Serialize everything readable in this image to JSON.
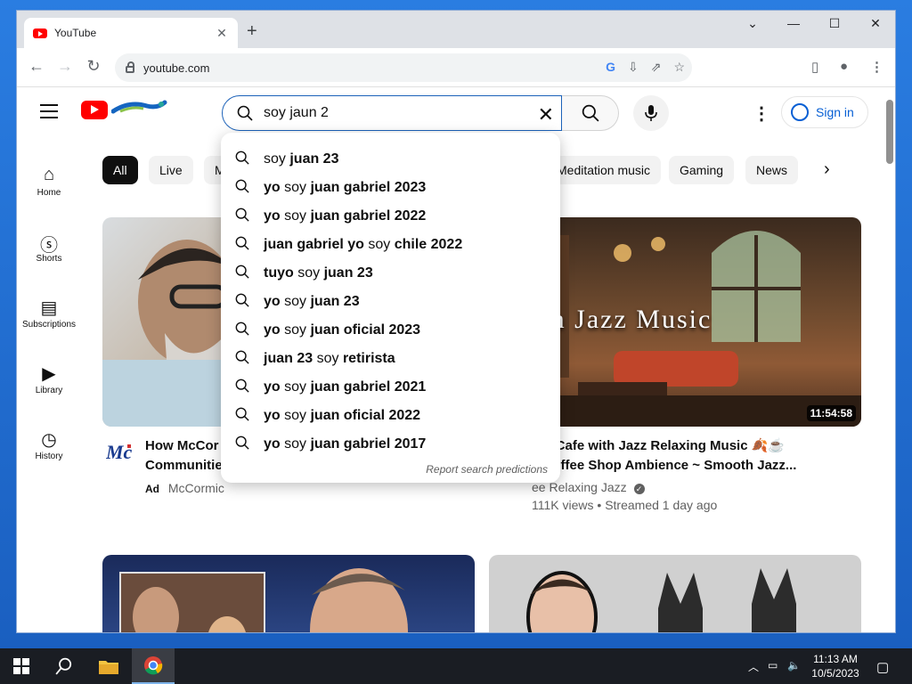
{
  "browser": {
    "tab_title": "YouTube",
    "url": "youtube.com"
  },
  "youtube": {
    "search": {
      "value": "soy jaun 2",
      "suggestions": [
        {
          "pre": "soy ",
          "bold": "juan 23",
          "post": ""
        },
        {
          "pre": "",
          "bold": "yo",
          "mid": " soy ",
          "bold2": "juan gabriel 2023"
        },
        {
          "pre": "",
          "bold": "yo",
          "mid": " soy ",
          "bold2": "juan gabriel 2022"
        },
        {
          "pre": "",
          "bold": "juan gabriel yo",
          "mid": " soy ",
          "bold2": "chile 2022"
        },
        {
          "pre": "",
          "bold": "tuyo",
          "mid": " soy ",
          "bold2": "juan 23"
        },
        {
          "pre": "",
          "bold": "yo",
          "mid": " soy ",
          "bold2": "juan 23"
        },
        {
          "pre": "",
          "bold": "yo",
          "mid": " soy ",
          "bold2": "juan oficial 2023"
        },
        {
          "pre": "",
          "bold": "juan 23",
          "mid": " soy ",
          "bold2": "retirista"
        },
        {
          "pre": "",
          "bold": "yo",
          "mid": " soy ",
          "bold2": "juan gabriel 2021"
        },
        {
          "pre": "",
          "bold": "yo",
          "mid": " soy ",
          "bold2": "juan oficial 2022"
        },
        {
          "pre": "",
          "bold": "yo",
          "mid": " soy ",
          "bold2": "juan gabriel 2017"
        }
      ],
      "report_label": "Report search predictions"
    },
    "signin_label": "Sign in",
    "sidebar": [
      {
        "label": "Home",
        "icon": "home-icon"
      },
      {
        "label": "Shorts",
        "icon": "shorts-icon"
      },
      {
        "label": "Subscriptions",
        "icon": "subscriptions-icon"
      },
      {
        "label": "Library",
        "icon": "library-icon"
      },
      {
        "label": "History",
        "icon": "history-icon"
      }
    ],
    "chips": [
      "All",
      "Live",
      "M",
      "Meditation music",
      "Gaming",
      "News"
    ],
    "videos": [
      {
        "title_line1": "How McCor",
        "title_line2": "Communitie",
        "ad_label": "Ad",
        "channel": "McCormic"
      },
      {
        "title_line1": "mn Cafe with Jazz Relaxing Music 🍂☕",
        "title_line2": "y Coffee Shop Ambience ~ Smooth Jazz...",
        "channel": "ee Relaxing Jazz",
        "meta": "111K views • Streamed 1 day ago",
        "duration": "11:54:58",
        "thumb_text": "mooth Jazz Music"
      }
    ]
  },
  "taskbar": {
    "time": "11:13 AM",
    "date": "10/5/2023"
  },
  "colors": {
    "youtube_red": "#ff0000",
    "link_blue": "#065fd4",
    "search_border": "#1c62b9"
  }
}
